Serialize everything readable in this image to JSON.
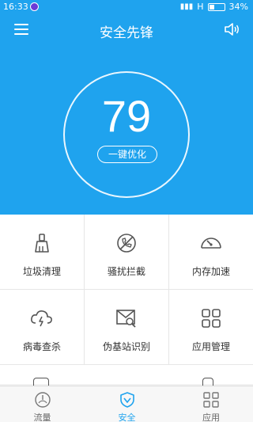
{
  "status_bar": {
    "time": "16:33",
    "network": "H",
    "battery": "34%"
  },
  "header": {
    "title": "安全先锋"
  },
  "score": {
    "value": "79",
    "button_label": "一键优化"
  },
  "grid": {
    "items": [
      {
        "label": "垃圾清理",
        "icon": "broom-icon"
      },
      {
        "label": "骚扰拦截",
        "icon": "phone-block-icon"
      },
      {
        "label": "内存加速",
        "icon": "speedometer-icon"
      },
      {
        "label": "病毒查杀",
        "icon": "virus-cloud-icon"
      },
      {
        "label": "伪基站识别",
        "icon": "envelope-search-icon"
      },
      {
        "label": "应用管理",
        "icon": "grid-apps-icon"
      }
    ]
  },
  "bottom_nav": {
    "items": [
      {
        "label": "流量",
        "icon": "gauge-icon",
        "active": false
      },
      {
        "label": "安全",
        "icon": "shield-icon",
        "active": true
      },
      {
        "label": "应用",
        "icon": "apps-icon",
        "active": false
      }
    ]
  },
  "colors": {
    "primary": "#1fa3ee",
    "icon": "#555555",
    "text": "#333333"
  }
}
